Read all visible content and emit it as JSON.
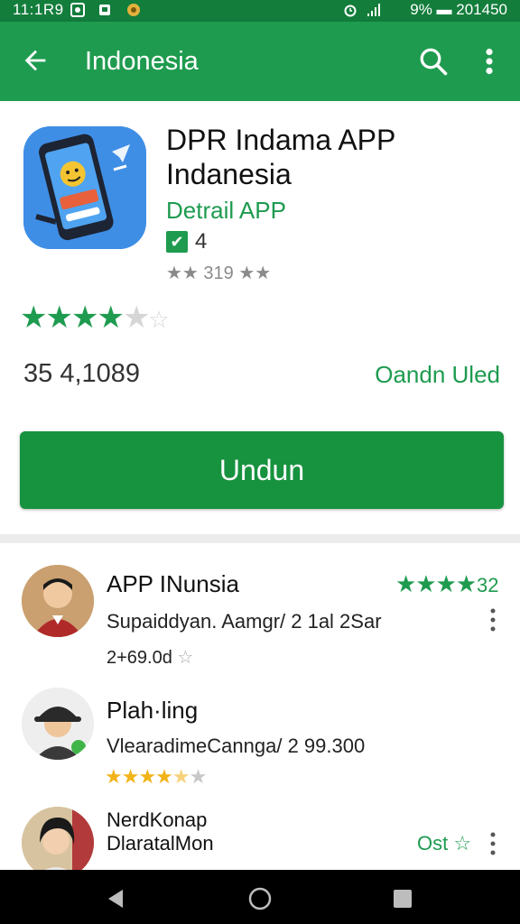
{
  "status_bar": {
    "left_text": "11:1R9",
    "right_text": "9% ▬ 201450"
  },
  "app_bar": {
    "title": "Indonesia",
    "back_icon": "arrow-back-icon",
    "search_icon": "search-icon",
    "more_icon": "more-vert-icon"
  },
  "app": {
    "title": "DPR Indama APP Indanesia",
    "subtitle": "Detrail APP",
    "verify_text": "4",
    "small_rating": "★★ 319 ★★",
    "rating_stars": 4,
    "count": "35 4,1089",
    "status_right": "Oandn Uled",
    "install_label": "Undun"
  },
  "reviews": [
    {
      "name": "APP INunsia",
      "text": "Supaiddyan. Aamgr/ 2 1al 2Sar",
      "subtext": "2+69.0d",
      "stars": 4,
      "score": "32",
      "star_color": "#1e9b4f"
    },
    {
      "name": "Plah·ling",
      "text": "VlearadimeCannga/ 2 99.300",
      "stars": 4,
      "star_color": "#f2b319"
    },
    {
      "name": "NerdKonap",
      "name2": "DlaratalMon",
      "side_text": "Ost ☆"
    }
  ],
  "colors": {
    "primary": "#1e9b4f",
    "status_bar": "#137d3c",
    "button": "#17923f",
    "gold": "#f2b319"
  }
}
